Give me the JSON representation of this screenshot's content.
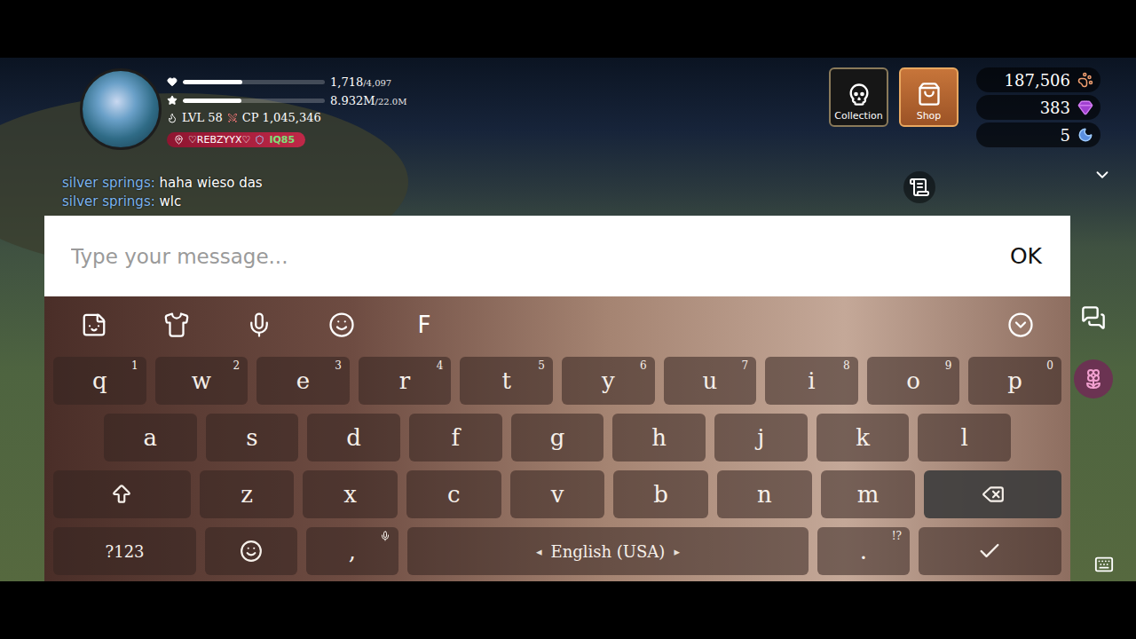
{
  "hud": {
    "hp_value": "1,718",
    "hp_max": "/4,097",
    "hp_level": 0.42,
    "xp_value": "8.932M",
    "xp_max": "/22.0M",
    "xp_level": 0.41,
    "level": "LVL 58",
    "cp": "CP 1,045,346",
    "name": "♡REBZYYX♡",
    "iq": "IQ85"
  },
  "top_buttons": [
    {
      "label": "Collection",
      "kind": "collection"
    },
    {
      "label": "Shop",
      "kind": "shop"
    }
  ],
  "currencies": [
    {
      "value": "187,506",
      "kind": "coin"
    },
    {
      "value": "383",
      "kind": "gem"
    },
    {
      "value": "5",
      "kind": "moon"
    }
  ],
  "chat": [
    {
      "sender": "silver springs:",
      "text": "haha wieso das"
    },
    {
      "sender": "silver springs:",
      "text": "wlc"
    }
  ],
  "input": {
    "placeholder": "Type your message...",
    "button": "OK"
  },
  "keyboard": {
    "toolbar": [
      {
        "kind": "sticker"
      },
      {
        "kind": "theme"
      },
      {
        "kind": "voice"
      },
      {
        "kind": "emoji"
      },
      {
        "kind": "font",
        "label": "F"
      },
      {
        "kind": "collapse"
      }
    ],
    "rows": [
      [
        {
          "kind": "char",
          "label": "q",
          "hint": "1"
        },
        {
          "kind": "char",
          "label": "w",
          "hint": "2"
        },
        {
          "kind": "char",
          "label": "e",
          "hint": "3"
        },
        {
          "kind": "char",
          "label": "r",
          "hint": "4"
        },
        {
          "kind": "char",
          "label": "t",
          "hint": "5"
        },
        {
          "kind": "char",
          "label": "y",
          "hint": "6"
        },
        {
          "kind": "char",
          "label": "u",
          "hint": "7"
        },
        {
          "kind": "char",
          "label": "i",
          "hint": "8"
        },
        {
          "kind": "char",
          "label": "o",
          "hint": "9"
        },
        {
          "kind": "char",
          "label": "p",
          "hint": "0"
        }
      ],
      [
        {
          "kind": "char",
          "label": "a"
        },
        {
          "kind": "char",
          "label": "s"
        },
        {
          "kind": "char",
          "label": "d"
        },
        {
          "kind": "char",
          "label": "f"
        },
        {
          "kind": "char",
          "label": "g"
        },
        {
          "kind": "char",
          "label": "h"
        },
        {
          "kind": "char",
          "label": "j"
        },
        {
          "kind": "char",
          "label": "k"
        },
        {
          "kind": "char",
          "label": "l"
        }
      ],
      [
        {
          "kind": "shift"
        },
        {
          "kind": "char",
          "label": "z"
        },
        {
          "kind": "char",
          "label": "x"
        },
        {
          "kind": "char",
          "label": "c"
        },
        {
          "kind": "char",
          "label": "v"
        },
        {
          "kind": "char",
          "label": "b"
        },
        {
          "kind": "char",
          "label": "n"
        },
        {
          "kind": "char",
          "label": "m"
        },
        {
          "kind": "backspace"
        }
      ],
      [
        {
          "kind": "mode",
          "label": "?123"
        },
        {
          "kind": "emoji"
        },
        {
          "kind": "comma",
          "label": ","
        },
        {
          "kind": "space",
          "label": "English (USA)",
          "left": "◂",
          "right": "▸"
        },
        {
          "kind": "char",
          "label": ".",
          "hint": "!?"
        },
        {
          "kind": "enter"
        }
      ]
    ]
  }
}
